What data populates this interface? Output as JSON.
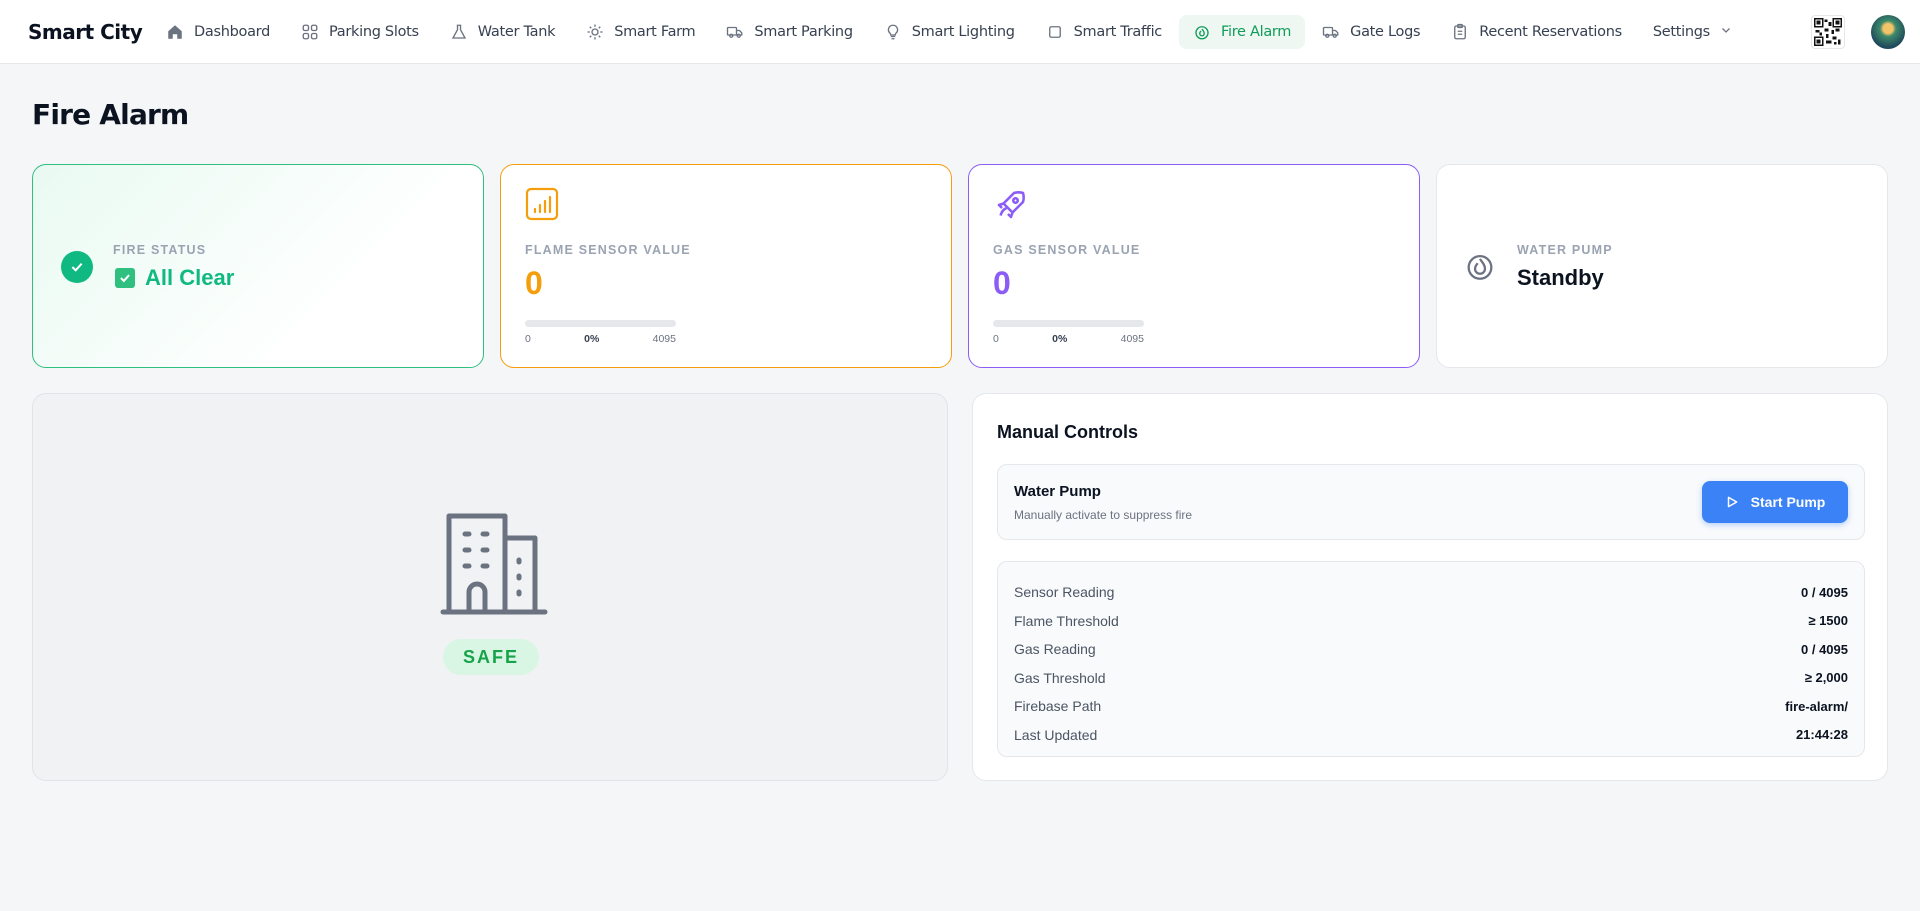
{
  "brand": "Smart City",
  "nav": {
    "items": [
      {
        "label": "Dashboard",
        "icon": "home-icon"
      },
      {
        "label": "Parking Slots",
        "icon": "grid-icon"
      },
      {
        "label": "Water Tank",
        "icon": "flask-icon"
      },
      {
        "label": "Smart Farm",
        "icon": "sun-icon"
      },
      {
        "label": "Smart Parking",
        "icon": "truck-icon"
      },
      {
        "label": "Smart Lighting",
        "icon": "lightbulb-icon"
      },
      {
        "label": "Smart Traffic",
        "icon": "square-icon"
      },
      {
        "label": "Fire Alarm",
        "icon": "flame-icon",
        "active": true
      },
      {
        "label": "Gate Logs",
        "icon": "truck-icon"
      },
      {
        "label": "Recent Reservations",
        "icon": "clipboard-icon"
      }
    ],
    "settings_label": "Settings"
  },
  "page_title": "Fire Alarm",
  "cards": {
    "fire_status": {
      "label": "FIRE STATUS",
      "value": "All Clear",
      "accent": "#10b981"
    },
    "flame": {
      "label": "FLAME SENSOR VALUE",
      "value": "0",
      "min": "0",
      "percent": "0%",
      "max": "4095",
      "fill_fraction": 0,
      "accent": "#f59e0b"
    },
    "gas": {
      "label": "GAS SENSOR VALUE",
      "value": "0",
      "min": "0",
      "percent": "0%",
      "max": "4095",
      "fill_fraction": 0,
      "accent": "#8b5cf6"
    },
    "pump": {
      "label": "WATER PUMP",
      "value": "Standby"
    }
  },
  "building": {
    "status": "SAFE"
  },
  "controls": {
    "title": "Manual Controls",
    "pump_title": "Water Pump",
    "pump_subtitle": "Manually activate to suppress fire",
    "button_label": "Start Pump",
    "button_color": "#3b82f6",
    "info": [
      {
        "key": "Sensor Reading",
        "value": "0 / 4095"
      },
      {
        "key": "Flame Threshold",
        "value": "≥ 1500"
      },
      {
        "key": "Gas Reading",
        "value": "0 / 4095"
      },
      {
        "key": "Gas Threshold",
        "value": "≥ 2,000"
      },
      {
        "key": "Firebase Path",
        "value": "fire-alarm/"
      },
      {
        "key": "Last Updated",
        "value": "21:44:28"
      }
    ]
  }
}
